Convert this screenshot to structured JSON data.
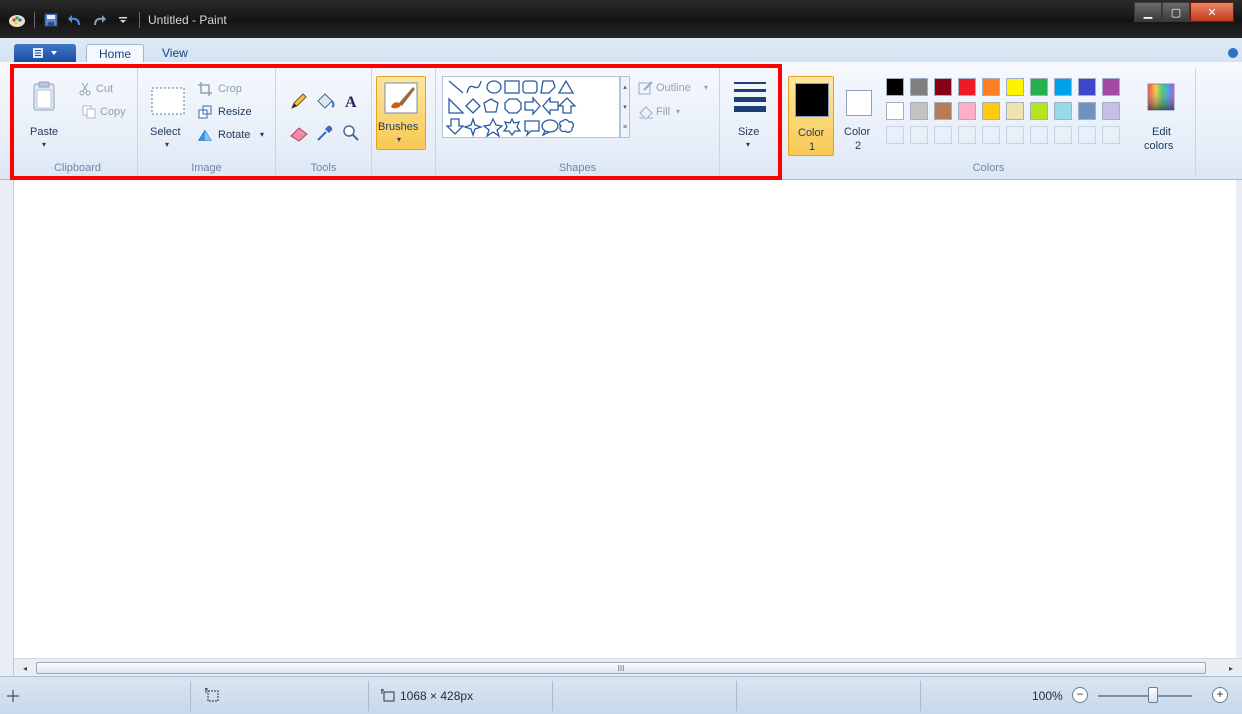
{
  "window": {
    "title": "Untitled - Paint",
    "min_glyph": "▁",
    "max_glyph": "▢",
    "close_glyph": "✕"
  },
  "tabs": {
    "home": "Home",
    "view": "View"
  },
  "clipboard": {
    "paste": "Paste",
    "cut": "Cut",
    "copy": "Copy",
    "group": "Clipboard"
  },
  "image": {
    "select": "Select",
    "crop": "Crop",
    "resize": "Resize",
    "rotate": "Rotate",
    "group": "Image"
  },
  "tools": {
    "group": "Tools"
  },
  "brushes": {
    "label": "Brushes"
  },
  "shapes": {
    "outline": "Outline",
    "fill": "Fill",
    "group": "Shapes"
  },
  "size": {
    "label": "Size"
  },
  "colors": {
    "color1_line1": "Color",
    "color1_line2": "1",
    "color2_line1": "Color",
    "color2_line2": "2",
    "edit_line1": "Edit",
    "edit_line2": "colors",
    "group": "Colors",
    "color1_value": "#000000",
    "color2_value": "#ffffff",
    "palette_row1": [
      "#000000",
      "#7f7f7f",
      "#880015",
      "#ed1c24",
      "#ff7f27",
      "#fff200",
      "#22b14c",
      "#00a2e8",
      "#3f48cc",
      "#a349a4"
    ],
    "palette_row2": [
      "#ffffff",
      "#c3c3c3",
      "#b97a57",
      "#ffaec9",
      "#ffc90e",
      "#efe4b0",
      "#b5e61d",
      "#99d9ea",
      "#7092be",
      "#c8bfe7"
    ]
  },
  "status": {
    "canvas_size": "1068 × 428px",
    "zoom": "100%",
    "zoom_out": "−",
    "zoom_in": "+",
    "scroll_grip": "III"
  }
}
